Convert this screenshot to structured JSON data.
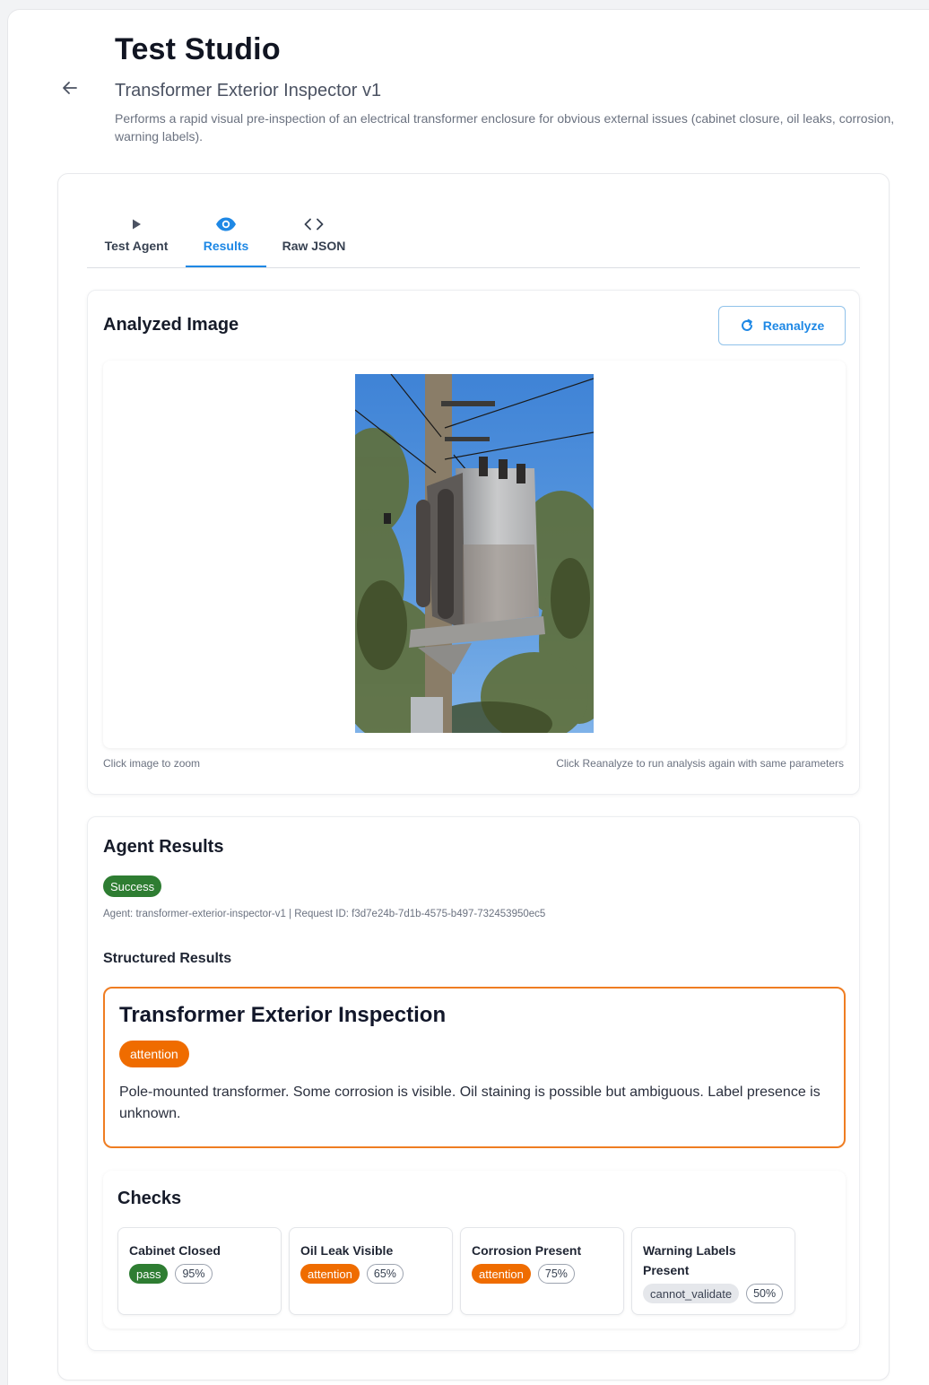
{
  "header": {
    "app_title": "Test Studio",
    "agent_name": "Transformer Exterior Inspector v1",
    "agent_description": "Performs a rapid visual pre-inspection of an electrical transformer enclosure for obvious external issues (cabinet closure, oil leaks, corrosion, warning labels)."
  },
  "tabs": [
    {
      "label": "Test Agent",
      "icon": "play-icon",
      "active": false
    },
    {
      "label": "Results",
      "icon": "eye-icon",
      "active": true
    },
    {
      "label": "Raw JSON",
      "icon": "code-icon",
      "active": false
    }
  ],
  "analyzed_image": {
    "title": "Analyzed Image",
    "reanalyze_label": "Reanalyze",
    "hint_left": "Click image to zoom",
    "hint_right": "Click Reanalyze to run analysis again with same parameters"
  },
  "agent_results": {
    "title": "Agent Results",
    "status": "Success",
    "meta": "Agent: transformer-exterior-inspector-v1 | Request ID: f3d7e24b-7d1b-4575-b497-732453950ec5",
    "structured_title": "Structured Results",
    "inspection": {
      "title": "Transformer Exterior Inspection",
      "status": "attention",
      "summary": "Pole-mounted transformer. Some corrosion is visible. Oil staining is possible but ambiguous. Label presence is unknown."
    },
    "checks_title": "Checks",
    "checks": [
      {
        "name": "Cabinet Closed",
        "status": "pass",
        "confidence": "95%"
      },
      {
        "name": "Oil Leak Visible",
        "status": "attention",
        "confidence": "65%"
      },
      {
        "name": "Corrosion Present",
        "status": "attention",
        "confidence": "75%"
      },
      {
        "name": "Warning Labels Present",
        "status": "cannot_validate",
        "confidence": "50%"
      }
    ]
  },
  "colors": {
    "accent": "#1e88e5",
    "success": "#2e7d32",
    "attention": "#ef6c00",
    "attention_border": "#ef7d22",
    "neutral_pill": "#e5e7eb"
  }
}
